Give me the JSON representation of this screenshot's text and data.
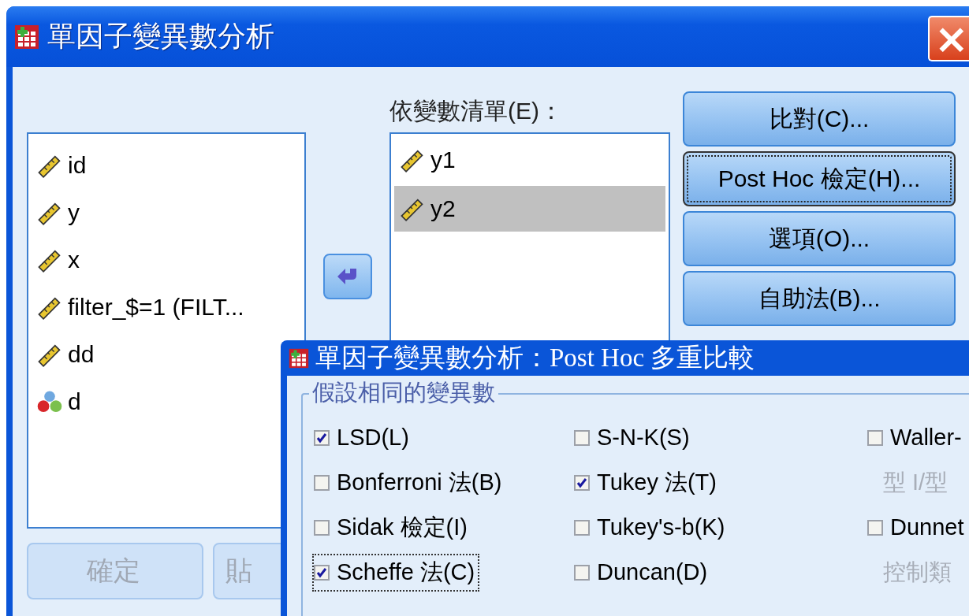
{
  "window": {
    "title": "單因子變異數分析",
    "close": "×"
  },
  "variables": [
    {
      "name": "id",
      "kind": "scale",
      "selected": false
    },
    {
      "name": "y",
      "kind": "scale",
      "selected": false
    },
    {
      "name": "x",
      "kind": "scale",
      "selected": false
    },
    {
      "name": "filter_$=1 (FILT...",
      "kind": "scale",
      "selected": false
    },
    {
      "name": "dd",
      "kind": "scale",
      "selected": false
    },
    {
      "name": "d",
      "kind": "nominal",
      "selected": false
    }
  ],
  "dependent_list": {
    "label": "依變數清單(E)：",
    "items": [
      {
        "name": "y1",
        "kind": "scale",
        "selected": false
      },
      {
        "name": "y2",
        "kind": "scale",
        "selected": true
      }
    ]
  },
  "side_buttons": [
    {
      "label": "比對(C)...",
      "focused": false
    },
    {
      "label": "Post Hoc 檢定(H)...",
      "focused": true
    },
    {
      "label": "選項(O)...",
      "focused": false
    },
    {
      "label": "自助法(B)...",
      "focused": false
    }
  ],
  "bottom_buttons": [
    {
      "label": "確定",
      "disabled": true
    },
    {
      "label": "貼",
      "disabled": true
    }
  ],
  "post_hoc_dialog": {
    "title": "單因子變異數分析：Post Hoc 多重比較",
    "group_label": "假設相同的變異數",
    "columns": [
      [
        {
          "kind": "checkbox",
          "label": "LSD(L)",
          "checked": true,
          "focused": false
        },
        {
          "kind": "checkbox",
          "label": "Bonferroni 法(B)",
          "checked": false,
          "focused": false
        },
        {
          "kind": "checkbox",
          "label": "Sidak 檢定(I)",
          "checked": false,
          "focused": false
        },
        {
          "kind": "checkbox",
          "label": "Scheffe 法(C)",
          "checked": true,
          "focused": true
        }
      ],
      [
        {
          "kind": "checkbox",
          "label": "S-N-K(S)",
          "checked": false,
          "focused": false
        },
        {
          "kind": "checkbox",
          "label": "Tukey 法(T)",
          "checked": true,
          "focused": false
        },
        {
          "kind": "checkbox",
          "label": "Tukey's-b(K)",
          "checked": false,
          "focused": false
        },
        {
          "kind": "checkbox",
          "label": "Duncan(D)",
          "checked": false,
          "focused": false
        }
      ],
      [
        {
          "kind": "checkbox",
          "label": "Waller-",
          "checked": false,
          "focused": false
        },
        {
          "kind": "label",
          "label": "型 I/型"
        },
        {
          "kind": "checkbox",
          "label": "Dunnet",
          "checked": false,
          "focused": false
        },
        {
          "kind": "label",
          "label": "控制類"
        }
      ]
    ]
  }
}
